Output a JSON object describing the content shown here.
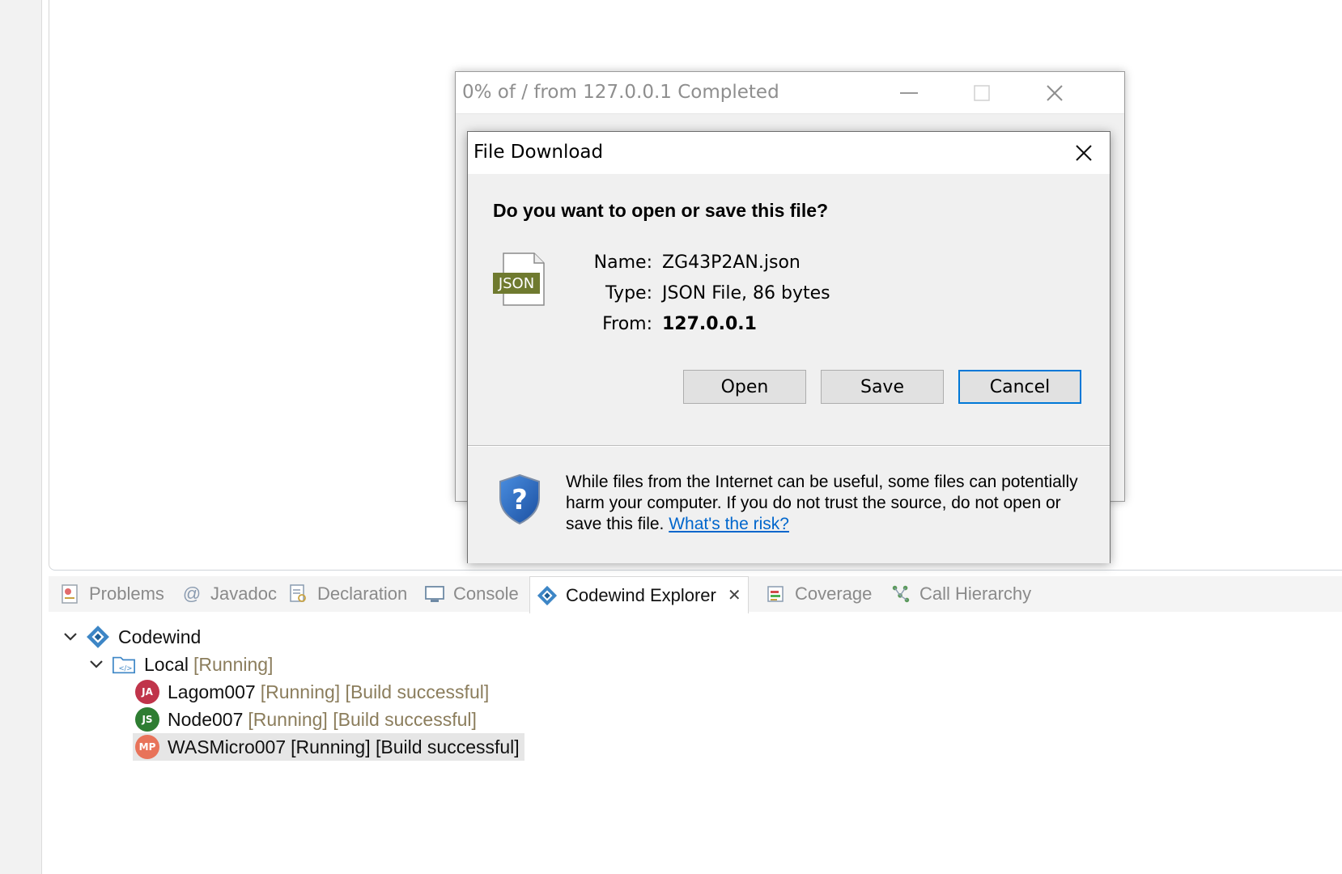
{
  "progress_window": {
    "title": "0% of / from 127.0.0.1 Completed"
  },
  "file_download": {
    "title": "File Download",
    "question": "Do you want to open or save this file?",
    "file_icon_label": "JSON",
    "name_label": "Name:",
    "name_value": "ZG43P2AN.json",
    "type_label": "Type:",
    "type_value": "JSON File, 86 bytes",
    "from_label": "From:",
    "from_value": "127.0.0.1",
    "open_label": "Open",
    "save_label": "Save",
    "cancel_label": "Cancel",
    "warning_text": "While files from the Internet can be useful, some files can potentially harm your computer. If you do not trust the source, do not open or save this file.",
    "risk_link": "What's the risk?"
  },
  "tabs": [
    {
      "label": "Problems",
      "icon": "problems-icon"
    },
    {
      "label": "Javadoc",
      "icon": "javadoc-icon"
    },
    {
      "label": "Declaration",
      "icon": "declaration-icon"
    },
    {
      "label": "Console",
      "icon": "console-icon"
    },
    {
      "label": "Codewind Explorer",
      "icon": "codewind-icon",
      "active": true
    },
    {
      "label": "Coverage",
      "icon": "coverage-icon"
    },
    {
      "label": "Call Hierarchy",
      "icon": "call-hierarchy-icon"
    }
  ],
  "tree": {
    "root": {
      "label": "Codewind"
    },
    "local": {
      "label": "Local",
      "status": "[Running]"
    },
    "projects": [
      {
        "badge": "JA",
        "color": "#c0344a",
        "name": "Lagom007",
        "status": "[Running] [Build successful]"
      },
      {
        "badge": "JS",
        "color": "#2e7d32",
        "name": "Node007",
        "status": "[Running] [Build successful]"
      },
      {
        "badge": "MP",
        "color": "#e8735a",
        "name": "WASMicro007",
        "status": "[Running] [Build successful]",
        "selected": true
      }
    ]
  }
}
